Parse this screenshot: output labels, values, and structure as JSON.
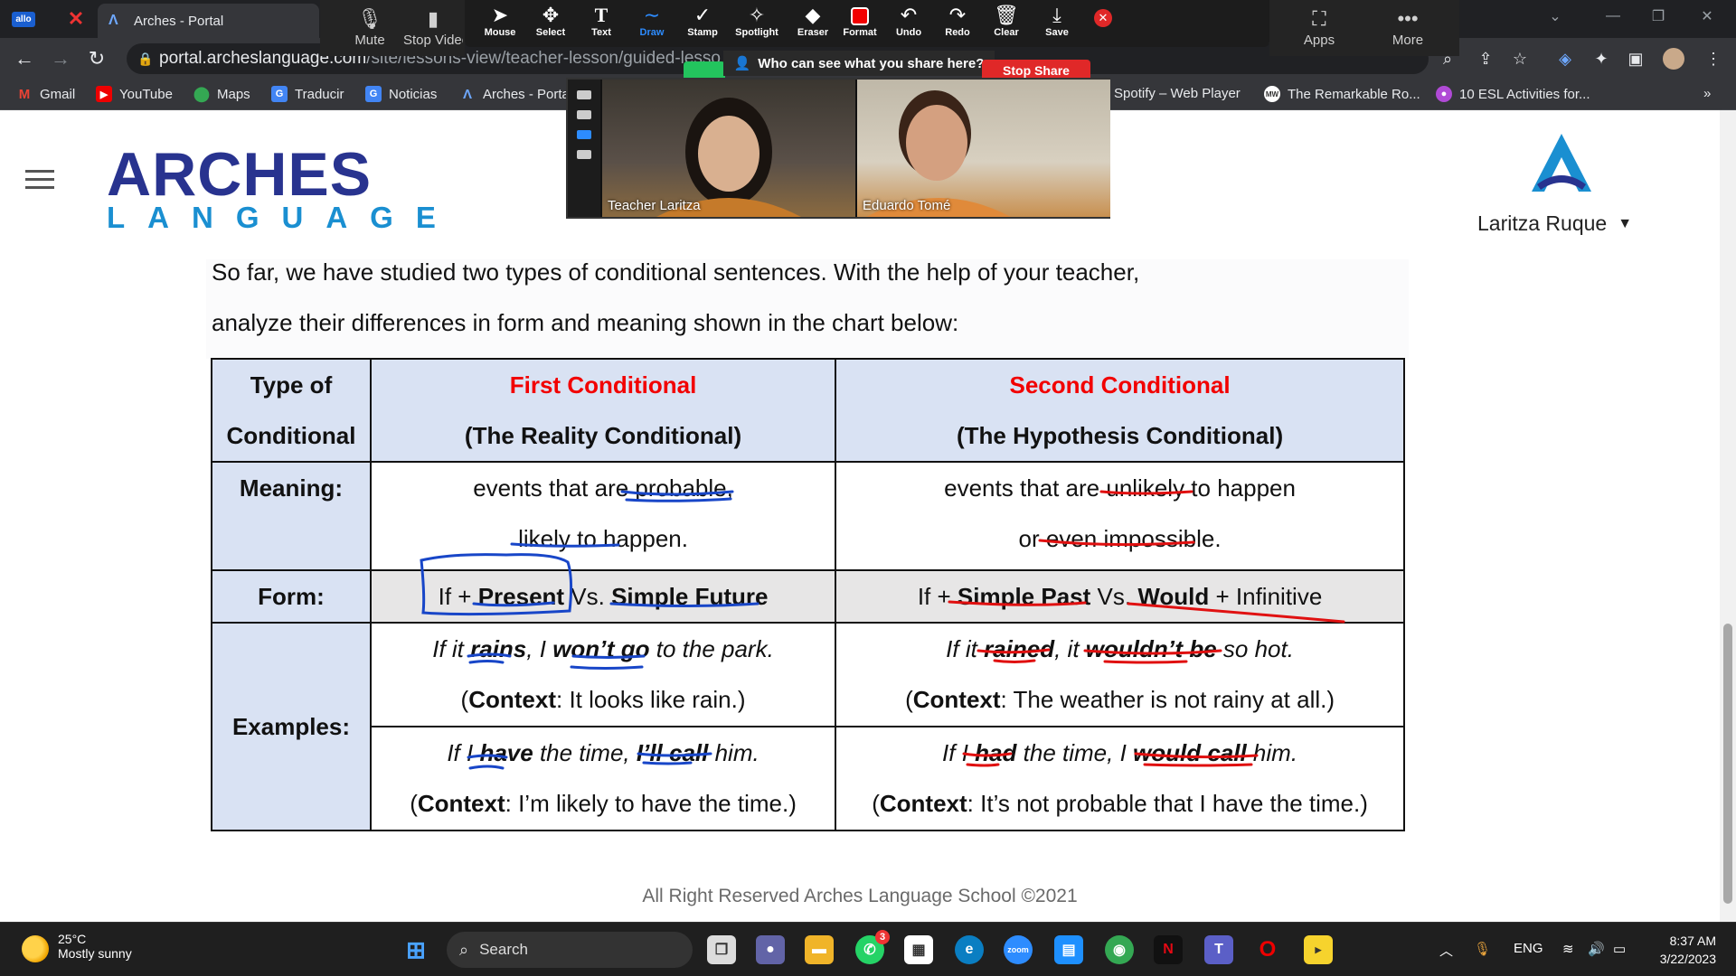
{
  "browser": {
    "tab_title": "Arches - Portal",
    "url_host": "portal.archeslanguage.com",
    "url_path": "/site/lessons-view/teacher-lesson/guided-lesso",
    "bookmarks": [
      "Gmail",
      "YouTube",
      "Maps",
      "Traducir",
      "Noticias",
      "Arches - Porta",
      "Spotify – Web Player",
      "The Remarkable Ro...",
      "10 ESL Activities for..."
    ],
    "bookmarks_overflow": "»"
  },
  "zoom": {
    "tools": [
      "Mouse",
      "Select",
      "Text",
      "Draw",
      "Stamp",
      "Spotlight",
      "Eraser",
      "Format",
      "Undo",
      "Redo",
      "Clear",
      "Save"
    ],
    "active_tool": "Draw",
    "left_items": [
      "Mute",
      "Stop Video"
    ],
    "right_items": [
      "Apps",
      "More"
    ],
    "share_prompt": "Who can see what you share here?",
    "stop_share": "Stop Share",
    "participants": [
      {
        "name": "Teacher Laritza"
      },
      {
        "name": "Eduardo Tomé"
      }
    ]
  },
  "site": {
    "logo_main": "ARCHES",
    "logo_sub": "LANGUAGE",
    "user_name": "Laritza Ruque"
  },
  "lesson": {
    "intro_line1": "So far, we have studied two types of conditional sentences. With the help of your teacher,",
    "intro_line2": "analyze their differences in form and meaning shown in the chart below:",
    "table": {
      "h_type_1": "Type of",
      "h_type_2": "Conditional",
      "first_title": "First Conditional",
      "first_sub": "(The Reality Conditional)",
      "second_title": "Second Conditional",
      "second_sub": "(The Hypothesis Conditional)",
      "meaning_label": "Meaning:",
      "first_meaning_1": "events that are probable,",
      "first_meaning_2": "likely to happen.",
      "second_meaning_1": "events that are unlikely to happen",
      "second_meaning_2": "or even impossible.",
      "form_label": "Form:",
      "first_form_if": "If + ",
      "first_form_a": "Present",
      "first_form_vs": " Vs. ",
      "first_form_b": "Simple Future",
      "second_form_if": "If + ",
      "second_form_a": "Simple Past",
      "second_form_vs": " Vs. ",
      "second_form_b": "Would",
      "second_form_c": " + Infinitive",
      "examples_label": "Examples:",
      "ex1_first_1": "If it ",
      "ex1_first_2": "rains",
      "ex1_first_3": ", I ",
      "ex1_first_4": "won’t go",
      "ex1_first_5": " to the park.",
      "ex1_first_ctx_label": "Context",
      "ex1_first_ctx": ": It looks like rain.)",
      "ex1_second_1": "If it ",
      "ex1_second_2": "rained",
      "ex1_second_3": ", it ",
      "ex1_second_4": "wouldn’t be",
      "ex1_second_5": " so hot.",
      "ex1_second_ctx_label": "Context",
      "ex1_second_ctx": ": The weather is not rainy at all.)",
      "ex2_first_1": "If I ",
      "ex2_first_2": "have",
      "ex2_first_3": " the time, ",
      "ex2_first_4": "I’ll call",
      "ex2_first_5": " him.",
      "ex2_first_ctx_label": "Context",
      "ex2_first_ctx": ": I’m likely to have the time.)",
      "ex2_second_1": "If I ",
      "ex2_second_2": "had",
      "ex2_second_3": " the time, I ",
      "ex2_second_4": "would call",
      "ex2_second_5": " him.",
      "ex2_second_ctx_label": "Context",
      "ex2_second_ctx": ": It’s not probable that I have the time.)",
      "paren_open": "("
    },
    "footer": "All Right Reserved Arches Language School ©2021"
  },
  "taskbar": {
    "temperature": "25°C",
    "weather": "Mostly sunny",
    "search": "Search",
    "whatsapp_badge": "3",
    "lang": "ENG",
    "time": "8:37 AM",
    "date": "3/22/2023"
  },
  "colors": {
    "accent_red": "#f20000",
    "header_blue": "#d9e2f3",
    "form_gray": "#e7e6e6",
    "logo_navy": "#28338f",
    "logo_blue": "#1a8fd1",
    "zoom_blue": "#2d8cff",
    "ink_blue": "#1846c8",
    "ink_red": "#e01010"
  }
}
